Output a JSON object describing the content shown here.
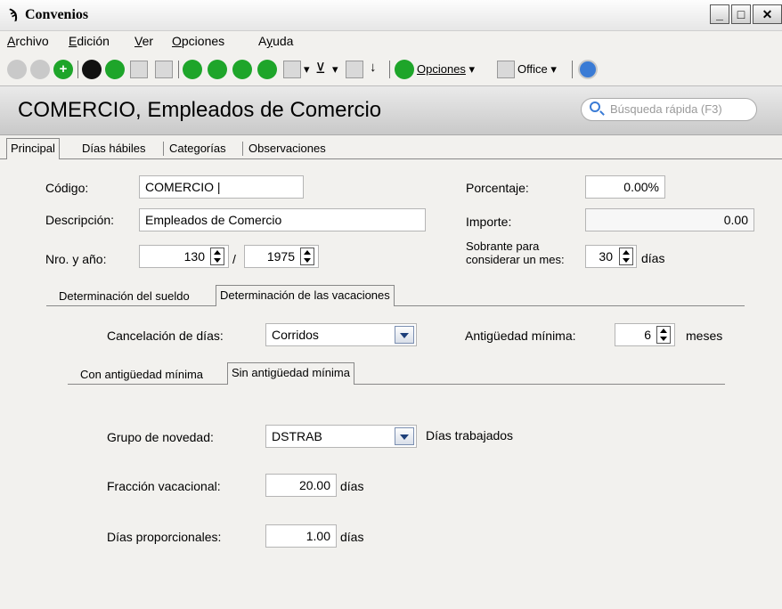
{
  "window": {
    "title": "Convenios",
    "icon": "app-icon"
  },
  "menu": [
    {
      "label": "Archivo",
      "u": "A",
      "rest": "rchivo"
    },
    {
      "label": "Edición",
      "u": "E",
      "rest": "dición"
    },
    {
      "label": "Ver",
      "u": "V",
      "rest": "er"
    },
    {
      "label": "Opciones",
      "u": "O",
      "rest": "pciones"
    },
    {
      "label": "Ayuda",
      "u": "A",
      "pre": "A",
      "u2": "y",
      "rest": "uda"
    }
  ],
  "toolbar": {
    "opciones_label": "Opciones",
    "office_label": "Office"
  },
  "header": {
    "title": "COMERCIO, Empleados de Comercio",
    "search_placeholder": "Búsqueda rápida (F3)"
  },
  "tabs": [
    "Principal",
    "Días hábiles",
    "Categorías",
    "Observaciones"
  ],
  "form": {
    "codigo_label": "Código:",
    "codigo_value": "COMERCIO",
    "descripcion_label": "Descripción:",
    "descripcion_value": "Empleados de Comercio",
    "nro_label": "Nro. y año:",
    "nro_value": "130",
    "nro_sep": "/",
    "anio_value": "1975",
    "porcentaje_label": "Porcentaje:",
    "porcentaje_value": "0.00%",
    "importe_label": "Importe:",
    "importe_value": "0.00",
    "sobrante_label_1": "Sobrante para",
    "sobrante_label_2": "considerar un mes:",
    "sobrante_value": "30",
    "sobrante_unit": "días"
  },
  "subtabs": [
    "Determinación del sueldo",
    "Determinación de las vacaciones"
  ],
  "vacaciones": {
    "cancelacion_label": "Cancelación de días:",
    "cancelacion_value": "Corridos",
    "antiguedad_label": "Antigüedad mínima:",
    "antiguedad_value": "6",
    "antiguedad_unit": "meses"
  },
  "subsubtabs": [
    "Con antigüedad mínima",
    "Sin antigüedad mínima"
  ],
  "sin_antiguedad": {
    "grupo_label": "Grupo de novedad:",
    "grupo_value": "DSTRAB",
    "grupo_desc": "Días trabajados",
    "fraccion_label": "Fracción vacacional:",
    "fraccion_value": "20.00",
    "fraccion_unit": "días",
    "proporcionales_label": "Días proporcionales:",
    "proporcionales_value": "1.00",
    "proporcionales_unit": "días"
  }
}
